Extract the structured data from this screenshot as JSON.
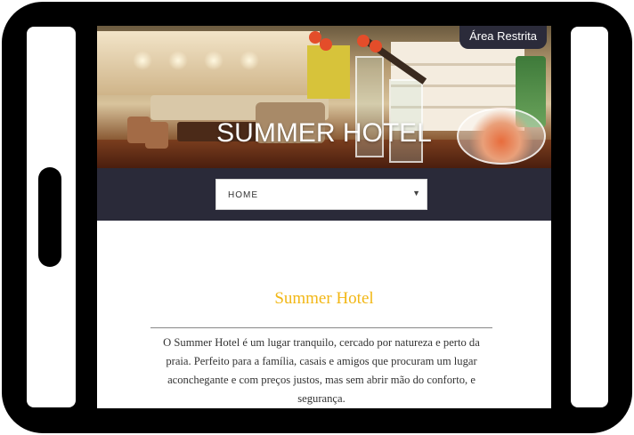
{
  "header": {
    "site_title": "SUMMER HOTEL",
    "restricted_area_label": "Área Restrita"
  },
  "nav": {
    "selected_value": "HOME",
    "caret": "▼"
  },
  "content": {
    "section_title": "Summer Hotel",
    "description": "O Summer Hotel é um lugar tranquilo, cercado por natureza e perto da praia.  Perfeito para a família, casais e amigos que procuram um lugar aconchegante e com preços justos, mas sem abrir mão do conforto, e segurança."
  },
  "colors": {
    "accent": "#f2b715",
    "nav_background": "#2a2a39",
    "frame": "#000000"
  },
  "icons": {
    "dropdown": "chevron-down-icon",
    "home_button": "tablet-home-button"
  }
}
